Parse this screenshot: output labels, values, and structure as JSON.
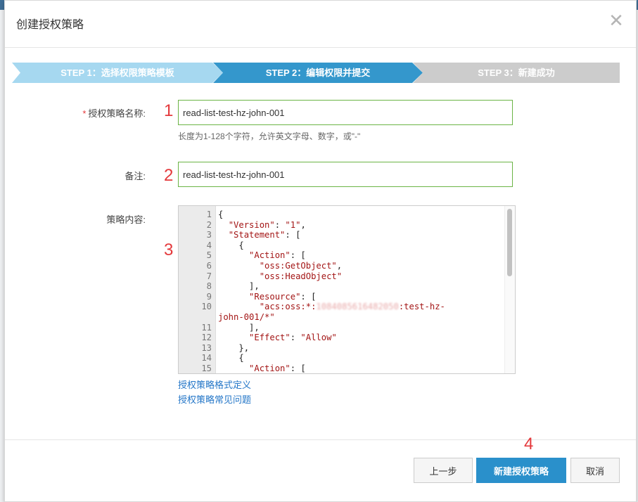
{
  "modal": {
    "title": "创建授权策略",
    "close_icon": "close-icon"
  },
  "steps": [
    {
      "label": "STEP 1：选择权限策略模板",
      "state": "done",
      "color": "#a6d8f0"
    },
    {
      "label": "STEP 2：编辑权限并提交",
      "state": "active",
      "color": "#3497cc"
    },
    {
      "label": "STEP 3：新建成功",
      "state": "pending",
      "color": "#cccccc"
    }
  ],
  "form": {
    "name_label": "授权策略名称:",
    "name_required_mark": "*",
    "name_value": "read-list-test-hz-john-001",
    "name_hint": "长度为1-128个字符，允许英文字母、数字，或\"-\"",
    "remark_label": "备注:",
    "remark_value": "read-list-test-hz-john-001",
    "content_label": "策略内容:"
  },
  "annotations": [
    "1",
    "2",
    "3",
    "4"
  ],
  "editor": {
    "line_numbers": [
      "1",
      "2",
      "3",
      "4",
      "5",
      "6",
      "7",
      "8",
      "9",
      "10",
      "11",
      "12",
      "13",
      "14",
      "15"
    ],
    "lines": {
      "l1": "{",
      "l2_key": "\"Version\"",
      "l2_val": "\"1\"",
      "l3_key": "\"Statement\"",
      "l4": "{",
      "l5_key": "\"Action\"",
      "l6_val": "\"oss:GetObject\"",
      "l7_val": "\"oss:HeadObject\"",
      "l8": "],",
      "l9_key": "\"Resource\"",
      "l10_pre": "\"acs:oss:*:",
      "l10_hidden": "1084085616482050",
      "l10_post": ":test-hz-",
      "l10_cont": "john-001/*\"",
      "l11": "],",
      "l12_key": "\"Effect\"",
      "l12_val": "\"Allow\"",
      "l13": "},",
      "l14": "{",
      "l15_key": "\"Action\""
    }
  },
  "links": {
    "format_definition": "授权策略格式定义",
    "faq": "授权策略常见问题"
  },
  "buttons": {
    "prev": "上一步",
    "create": "新建授权策略",
    "cancel": "取消"
  },
  "colors": {
    "primary": "#2a90cb",
    "input_border_valid": "#6bb445",
    "annotation": "#e4393c",
    "link": "#2577c8"
  }
}
